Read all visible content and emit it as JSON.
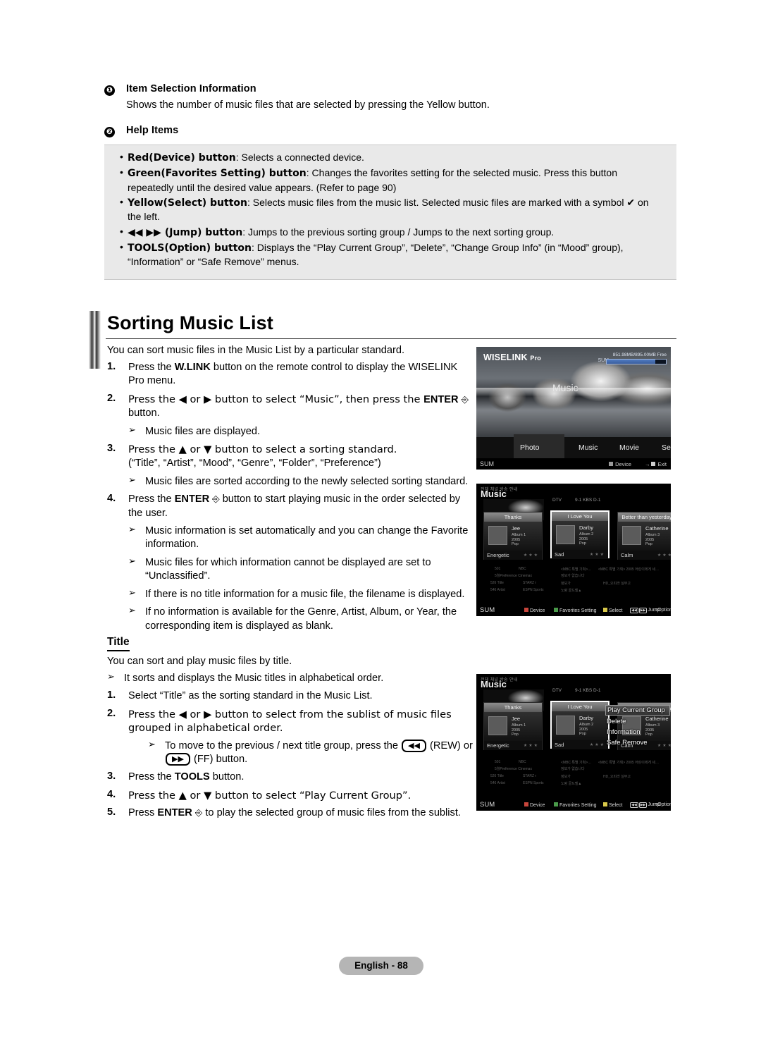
{
  "top": {
    "item5": {
      "num": "❶",
      "heading": "Item Selection Information",
      "body": "Shows the number of music files that are selected by pressing the Yellow button."
    },
    "item6": {
      "num": "❷",
      "heading": "Help Items"
    }
  },
  "help_items": [
    {
      "bold": "Red(Device) button",
      "rest": ": Selects a connected device.",
      "cont": ""
    },
    {
      "bold": "Green(Favorites Setting) button",
      "rest": ": Changes the favorites setting for the selected music. Press this button",
      "cont": "repeatedly until the desired value appears. (Refer to page 90)"
    },
    {
      "bold": "Yellow(Select) button",
      "rest": ": Selects music files from the music list. Selected music files are marked with a symbol ✔ on",
      "cont": "the left."
    },
    {
      "bold": "◀◀ ▶▶ (Jump) button",
      "rest": ": Jumps to the previous sorting group / Jumps to the next sorting group.",
      "cont": ""
    },
    {
      "bold": "TOOLS(Option) button",
      "rest": ": Displays the “Play Current Group”, “Delete”, “Change Group Info” (in “Mood” group),",
      "cont": "“Information” or “Safe Remove” menus."
    }
  ],
  "section": {
    "title": "Sorting Music List",
    "lead": "You can sort music files in the Music List by a particular standard."
  },
  "steps": [
    {
      "n": "1.",
      "pre": "Press the ",
      "b": "W.LINK",
      "post": " button on the remote control to display the WISELINK Pro menu."
    },
    {
      "n": "2.",
      "pre": "Press the ◀ or ▶ button to select “Music”, then press the ",
      "b": "ENTER",
      "post": " button."
    },
    {
      "n": "3.",
      "pre": "Press the ▲ or ▼ button to select a sorting standard.",
      "b": "",
      "post": "",
      "line2": "(“Title”, “Artist”, “Mood”, “Genre”, “Folder”, “Preference”)"
    },
    {
      "n": "4.",
      "pre": "Press the ",
      "b": "ENTER",
      "post": " button to start playing music in the order selected by the user."
    }
  ],
  "bullets": {
    "b1": "Music files are displayed.",
    "b2": "Music files are sorted according to the newly selected sorting standard.",
    "b3": "Music information is set automatically and you can change the Favorite information.",
    "b4": "Music files for which information cannot be displayed are set to “Unclassified”.",
    "b5": "If there is no title information for a music file, the filename is displayed.",
    "b6": "If no information is available for the Genre, Artist, Album, or Year, the corresponding item is displayed as blank.",
    "arrow": "➢"
  },
  "title_sub": {
    "heading": "Title",
    "lead": "You can sort and play music files by title.",
    "bullet": "It sorts and displays the Music titles in alphabetical order.",
    "steps": [
      {
        "n": "1.",
        "text": "Select “Title” as the sorting standard in the Music List."
      },
      {
        "n": "2.",
        "text": "Press the ◀ or ▶ button to select from the sublist of music files grouped in alphabetical order."
      },
      {
        "n": "3.",
        "pre": "Press the ",
        "b": "TOOLS",
        "post": " button."
      },
      {
        "n": "4.",
        "text": "Press the ▲ or ▼ button to select “Play Current Group”."
      },
      {
        "n": "5.",
        "pre": "Press ",
        "b": "ENTER",
        "post": " to play the selected group of music files from the sublist."
      }
    ],
    "rew_note_pre": "To move to the previous / next title group, press the ",
    "rew_key": "◀◀",
    "rew_note_mid": " (REW) or ",
    "ff_key": "▶▶",
    "rew_note_end": " (FF) button."
  },
  "tv1": {
    "logo": "WISELINK",
    "logo_small": "Pro",
    "watermark": "Music",
    "sum_label": "SUM",
    "capacity": "851.98MB/895.00MB Free",
    "nav": [
      "Photo",
      "Music",
      "Movie",
      "Setup"
    ],
    "foot_sum": "SUM",
    "foot_device": "Device",
    "foot_exit": "Exit"
  },
  "tv2": {
    "kr_head": "전체 채널 방송 안내",
    "title": "Music",
    "dtv": "DTV",
    "channel": "9-1 KBS D-1",
    "cards": [
      {
        "title": "Thanks",
        "artist": "Jee",
        "album": "Album 1",
        "year": "2005",
        "genre": "Pop",
        "mood": "Energetic",
        "stars": "★★★"
      },
      {
        "title": "I Love You",
        "artist": "Darby",
        "album": "Album 2",
        "year": "2005",
        "genre": "Pop",
        "mood": "Sad",
        "stars": "★★★"
      },
      {
        "title": "Better than yesterday",
        "artist": "Catherine",
        "album": "Album 3",
        "year": "2005",
        "genre": "Pop",
        "mood": "Calm",
        "stars": "★★★"
      }
    ],
    "epg": {
      "c1": "501",
      "c2": "NBC",
      "c3": "<MBC 특별 기획>…",
      "c4": "<MBC 특별 기획> 2005 어린이에게 세…",
      "c5": "5월Preference Cinemax",
      "c6": "정보가 없습니다",
      "c7": "526 Title",
      "c8": "STARZ r",
      "c9": "정보가",
      "c10": "HD_오피라 실부고",
      "c11": "546 Artist",
      "c12": "ESPN Sports",
      "c13": "노량 골드벨▲"
    },
    "foot_sum": "SUM",
    "foot": [
      {
        "label": "Device",
        "color": "#c8463c"
      },
      {
        "label": "Favorites Setting",
        "color": "#4a9a4a"
      },
      {
        "label": "Select",
        "color": "#d8c84a"
      }
    ],
    "foot_jump": "Jump",
    "foot_option": "Option"
  },
  "tv3": {
    "popup": [
      "Play Current Group",
      "Delete",
      "Information",
      "Safe Remove"
    ]
  },
  "footer": {
    "page": "English - 88"
  }
}
